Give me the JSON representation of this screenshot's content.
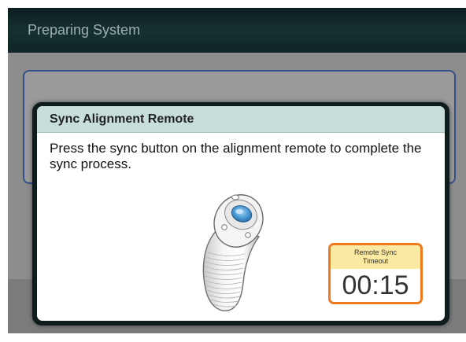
{
  "window": {
    "title": "Preparing System"
  },
  "dialog": {
    "title": "Sync Alignment Remote",
    "message": "Press the sync button on the alignment remote to complete the sync process.",
    "illustration_icon": "alignment-remote-icon",
    "timer": {
      "label_line1": "Remote Sync",
      "label_line2": "Timeout",
      "value": "00:15"
    }
  },
  "colors": {
    "titlebar": "#15302f",
    "dialog_header": "#c7dedd",
    "timer_border": "#ef7a1e",
    "timer_label_bg": "#fae9a1",
    "background_panel_border": "#34508a"
  }
}
